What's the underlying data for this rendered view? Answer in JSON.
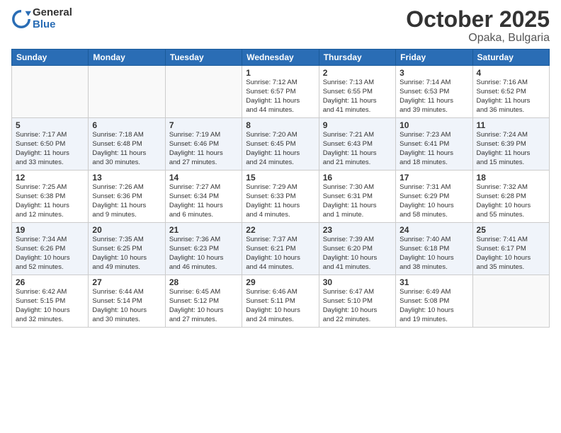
{
  "header": {
    "logo_general": "General",
    "logo_blue": "Blue",
    "month": "October 2025",
    "location": "Opaka, Bulgaria"
  },
  "weekdays": [
    "Sunday",
    "Monday",
    "Tuesday",
    "Wednesday",
    "Thursday",
    "Friday",
    "Saturday"
  ],
  "weeks": [
    [
      {
        "day": "",
        "info": ""
      },
      {
        "day": "",
        "info": ""
      },
      {
        "day": "",
        "info": ""
      },
      {
        "day": "1",
        "info": "Sunrise: 7:12 AM\nSunset: 6:57 PM\nDaylight: 11 hours\nand 44 minutes."
      },
      {
        "day": "2",
        "info": "Sunrise: 7:13 AM\nSunset: 6:55 PM\nDaylight: 11 hours\nand 41 minutes."
      },
      {
        "day": "3",
        "info": "Sunrise: 7:14 AM\nSunset: 6:53 PM\nDaylight: 11 hours\nand 39 minutes."
      },
      {
        "day": "4",
        "info": "Sunrise: 7:16 AM\nSunset: 6:52 PM\nDaylight: 11 hours\nand 36 minutes."
      }
    ],
    [
      {
        "day": "5",
        "info": "Sunrise: 7:17 AM\nSunset: 6:50 PM\nDaylight: 11 hours\nand 33 minutes."
      },
      {
        "day": "6",
        "info": "Sunrise: 7:18 AM\nSunset: 6:48 PM\nDaylight: 11 hours\nand 30 minutes."
      },
      {
        "day": "7",
        "info": "Sunrise: 7:19 AM\nSunset: 6:46 PM\nDaylight: 11 hours\nand 27 minutes."
      },
      {
        "day": "8",
        "info": "Sunrise: 7:20 AM\nSunset: 6:45 PM\nDaylight: 11 hours\nand 24 minutes."
      },
      {
        "day": "9",
        "info": "Sunrise: 7:21 AM\nSunset: 6:43 PM\nDaylight: 11 hours\nand 21 minutes."
      },
      {
        "day": "10",
        "info": "Sunrise: 7:23 AM\nSunset: 6:41 PM\nDaylight: 11 hours\nand 18 minutes."
      },
      {
        "day": "11",
        "info": "Sunrise: 7:24 AM\nSunset: 6:39 PM\nDaylight: 11 hours\nand 15 minutes."
      }
    ],
    [
      {
        "day": "12",
        "info": "Sunrise: 7:25 AM\nSunset: 6:38 PM\nDaylight: 11 hours\nand 12 minutes."
      },
      {
        "day": "13",
        "info": "Sunrise: 7:26 AM\nSunset: 6:36 PM\nDaylight: 11 hours\nand 9 minutes."
      },
      {
        "day": "14",
        "info": "Sunrise: 7:27 AM\nSunset: 6:34 PM\nDaylight: 11 hours\nand 6 minutes."
      },
      {
        "day": "15",
        "info": "Sunrise: 7:29 AM\nSunset: 6:33 PM\nDaylight: 11 hours\nand 4 minutes."
      },
      {
        "day": "16",
        "info": "Sunrise: 7:30 AM\nSunset: 6:31 PM\nDaylight: 11 hours\nand 1 minute."
      },
      {
        "day": "17",
        "info": "Sunrise: 7:31 AM\nSunset: 6:29 PM\nDaylight: 10 hours\nand 58 minutes."
      },
      {
        "day": "18",
        "info": "Sunrise: 7:32 AM\nSunset: 6:28 PM\nDaylight: 10 hours\nand 55 minutes."
      }
    ],
    [
      {
        "day": "19",
        "info": "Sunrise: 7:34 AM\nSunset: 6:26 PM\nDaylight: 10 hours\nand 52 minutes."
      },
      {
        "day": "20",
        "info": "Sunrise: 7:35 AM\nSunset: 6:25 PM\nDaylight: 10 hours\nand 49 minutes."
      },
      {
        "day": "21",
        "info": "Sunrise: 7:36 AM\nSunset: 6:23 PM\nDaylight: 10 hours\nand 46 minutes."
      },
      {
        "day": "22",
        "info": "Sunrise: 7:37 AM\nSunset: 6:21 PM\nDaylight: 10 hours\nand 44 minutes."
      },
      {
        "day": "23",
        "info": "Sunrise: 7:39 AM\nSunset: 6:20 PM\nDaylight: 10 hours\nand 41 minutes."
      },
      {
        "day": "24",
        "info": "Sunrise: 7:40 AM\nSunset: 6:18 PM\nDaylight: 10 hours\nand 38 minutes."
      },
      {
        "day": "25",
        "info": "Sunrise: 7:41 AM\nSunset: 6:17 PM\nDaylight: 10 hours\nand 35 minutes."
      }
    ],
    [
      {
        "day": "26",
        "info": "Sunrise: 6:42 AM\nSunset: 5:15 PM\nDaylight: 10 hours\nand 32 minutes."
      },
      {
        "day": "27",
        "info": "Sunrise: 6:44 AM\nSunset: 5:14 PM\nDaylight: 10 hours\nand 30 minutes."
      },
      {
        "day": "28",
        "info": "Sunrise: 6:45 AM\nSunset: 5:12 PM\nDaylight: 10 hours\nand 27 minutes."
      },
      {
        "day": "29",
        "info": "Sunrise: 6:46 AM\nSunset: 5:11 PM\nDaylight: 10 hours\nand 24 minutes."
      },
      {
        "day": "30",
        "info": "Sunrise: 6:47 AM\nSunset: 5:10 PM\nDaylight: 10 hours\nand 22 minutes."
      },
      {
        "day": "31",
        "info": "Sunrise: 6:49 AM\nSunset: 5:08 PM\nDaylight: 10 hours\nand 19 minutes."
      },
      {
        "day": "",
        "info": ""
      }
    ]
  ]
}
